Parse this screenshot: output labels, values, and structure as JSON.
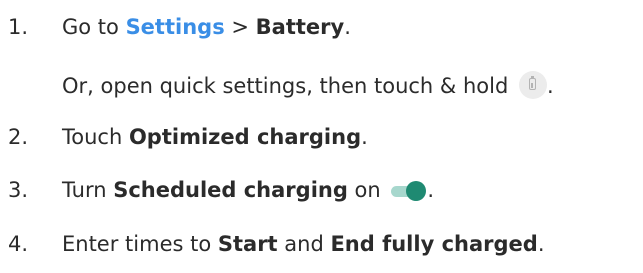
{
  "steps": [
    {
      "number": "1.",
      "prefix": "Go to ",
      "link": "Settings",
      "separator": " > ",
      "bold": "Battery",
      "suffix": ".",
      "continuation": {
        "text": "Or, open quick settings, then touch & hold ",
        "icon": "battery-saver-tile-icon",
        "suffix": "."
      }
    },
    {
      "number": "2.",
      "prefix": "Touch ",
      "bold": "Optimized charging",
      "suffix": "."
    },
    {
      "number": "3.",
      "prefix": "Turn ",
      "bold": "Scheduled charging",
      "middle": " on ",
      "icon": "toggle-on-icon",
      "suffix": "."
    },
    {
      "number": "4.",
      "prefix": "Enter times to ",
      "bold1": "Start",
      "middle": " and ",
      "bold2": "End fully charged",
      "suffix": "."
    }
  ],
  "colors": {
    "text": "#2b2b2b",
    "link": "#3a8ee6",
    "toggle_thumb": "#1f8a72",
    "toggle_track": "#a7d7cd",
    "tile_background": "#ececec"
  }
}
